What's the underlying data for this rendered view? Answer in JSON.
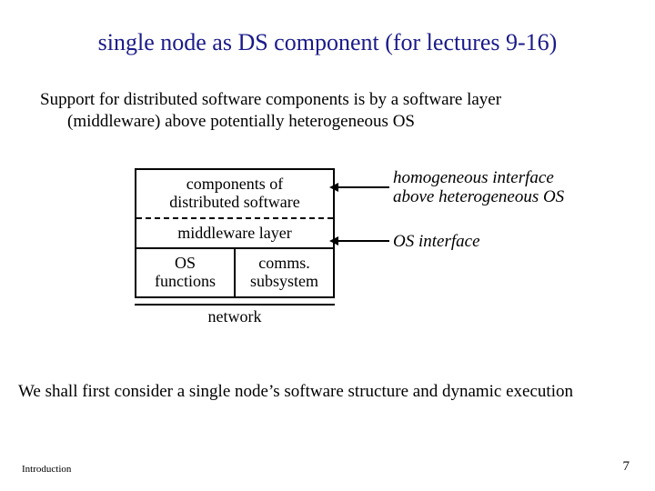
{
  "title": "single node as DS component (for lectures 9-16)",
  "support_line1": "Support for distributed software components is by a software layer",
  "support_line2": "(middleware) above potentially heterogeneous OS",
  "diagram": {
    "layer_components_l1": "components of",
    "layer_components_l2": "distributed software",
    "layer_middleware": "middleware layer",
    "os_functions_l1": "OS",
    "os_functions_l2": "functions",
    "comms_l1": "comms.",
    "comms_l2": "subsystem",
    "network": "network"
  },
  "annot_homog_l1": "homogeneous interface",
  "annot_homog_l2": "above heterogeneous OS",
  "annot_osif": "OS interface",
  "conclusion": "We shall first consider a single node’s software structure and dynamic execution",
  "footer_left": "Introduction",
  "footer_right": "7"
}
